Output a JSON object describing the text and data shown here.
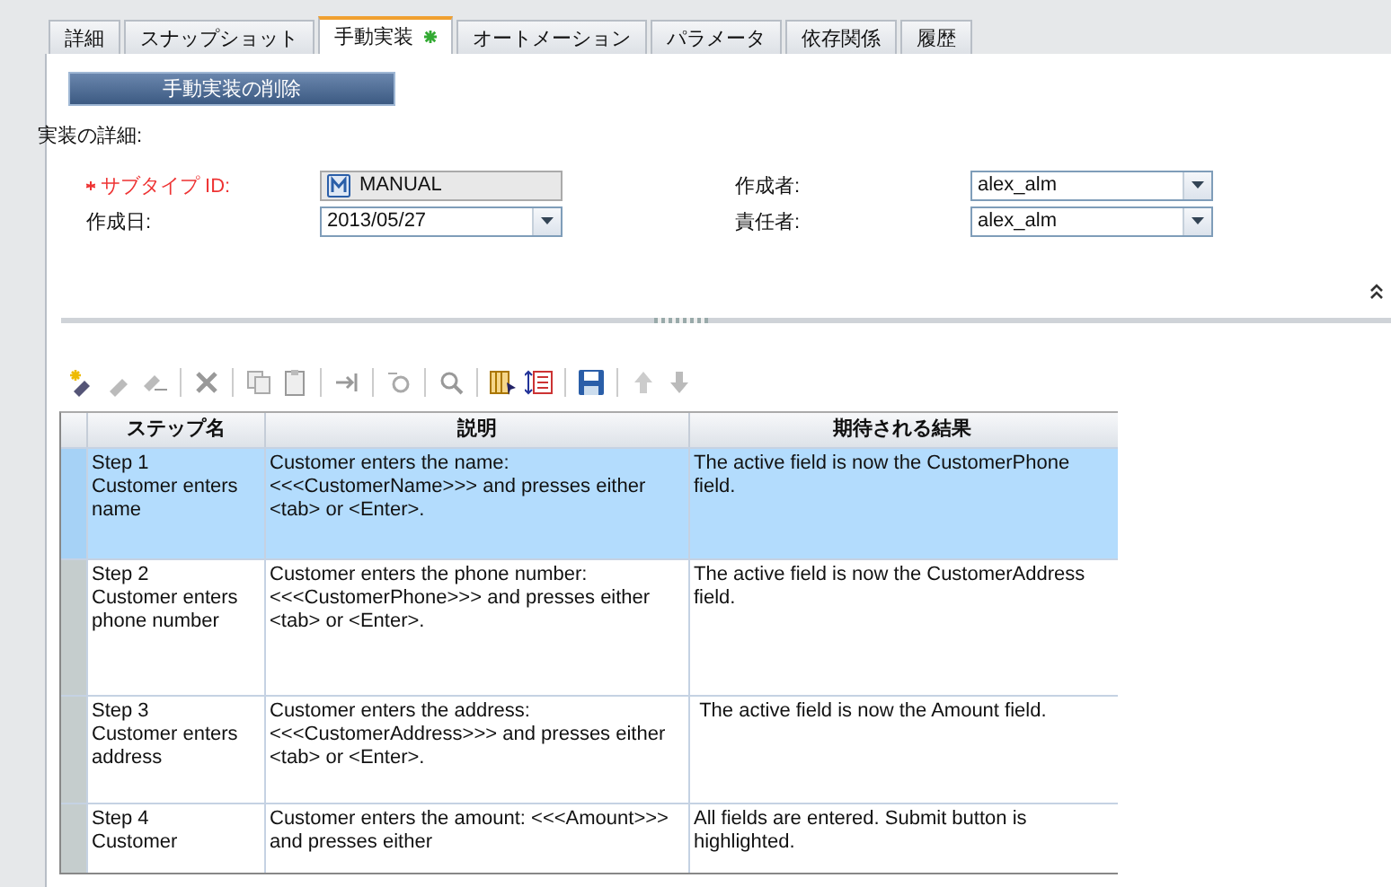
{
  "tabs": [
    {
      "label": "詳細",
      "selected": false,
      "modified": false
    },
    {
      "label": "スナップショット",
      "selected": false,
      "modified": false
    },
    {
      "label": "手動実装",
      "selected": true,
      "modified": true
    },
    {
      "label": "オートメーション",
      "selected": false,
      "modified": false
    },
    {
      "label": "パラメータ",
      "selected": false,
      "modified": false
    },
    {
      "label": "依存関係",
      "selected": false,
      "modified": false
    },
    {
      "label": "履歴",
      "selected": false,
      "modified": false
    }
  ],
  "delete_button": "手動実装の削除",
  "section_title": "実装の詳細:",
  "fields": [
    {
      "label": "サブタイプ ID:",
      "required": true,
      "kind": "readonly",
      "value": "MANUAL"
    },
    {
      "label": "作成者:",
      "required": false,
      "kind": "dropdown",
      "value": "alex_alm"
    },
    {
      "label": "作成日:",
      "required": false,
      "kind": "dropdown",
      "value": "2013/05/27"
    },
    {
      "label": "責任者:",
      "required": false,
      "kind": "dropdown",
      "value": "alex_alm"
    }
  ],
  "table": {
    "columns": [
      "ステップ名",
      "説明",
      "期待される結果"
    ],
    "rows": [
      {
        "selected": true,
        "name": "Step 1 Customer enters name",
        "description": "Customer enters the name: <<<CustomerName>>> and presses either <tab> or <Enter>.",
        "expected": "The active field is now the CustomerPhone field."
      },
      {
        "selected": false,
        "name": "Step 2 Customer enters phone number",
        "description": "Customer enters the phone number: <<<CustomerPhone>>> and presses either <tab> or <Enter>.",
        "expected": "The active field is now the CustomerAddress field."
      },
      {
        "selected": false,
        "name": "Step 3 Customer enters address",
        "description": "Customer enters the address: <<<CustomerAddress>>> and presses either <tab> or <Enter>.",
        "expected": " The active field is now the Amount field."
      },
      {
        "selected": false,
        "name": "Step 4 Customer",
        "description": "Customer enters the amount: <<<Amount>>> and presses either",
        "expected": "All fields are entered. Submit button is highlighted."
      }
    ]
  }
}
